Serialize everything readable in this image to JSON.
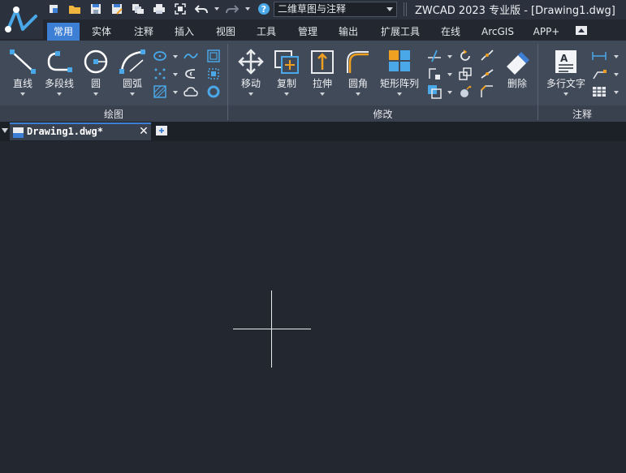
{
  "app": {
    "window_title": "ZWCAD 2023 专业版 - [Drawing1.dwg]",
    "logo_icon": "zwcad-logo-icon"
  },
  "quick_access": {
    "workspace": "二维草图与注释",
    "icons": [
      "new-file-icon",
      "open-folder-icon",
      "save-icon",
      "save-as-icon",
      "batch-plot-icon",
      "print-icon",
      "fullscreen-icon",
      "undo-icon",
      "redo-icon",
      "help-icon"
    ]
  },
  "menu_tabs": [
    "常用",
    "实体",
    "注释",
    "插入",
    "视图",
    "工具",
    "管理",
    "输出",
    "扩展工具",
    "在线",
    "ArcGIS",
    "APP+"
  ],
  "active_tab": "常用",
  "ribbon": {
    "draw": {
      "title": "绘图",
      "buttons": [
        "直线",
        "多段线",
        "圆",
        "圆弧"
      ]
    },
    "modify": {
      "title": "修改",
      "buttons": [
        "移动",
        "复制",
        "拉伸",
        "圆角",
        "矩形阵列",
        "删除"
      ]
    },
    "annotate": {
      "title": "注释",
      "buttons": [
        "多行文字"
      ]
    }
  },
  "document": {
    "tab_name": "Drawing1.dwg*",
    "close_symbol": "✕"
  },
  "colors": {
    "accent": "#3e7fd6",
    "ribbon_bg": "#414a58",
    "canvas_bg": "#222730",
    "icon_blue": "#4aa8e8",
    "icon_orange": "#f0a020"
  }
}
